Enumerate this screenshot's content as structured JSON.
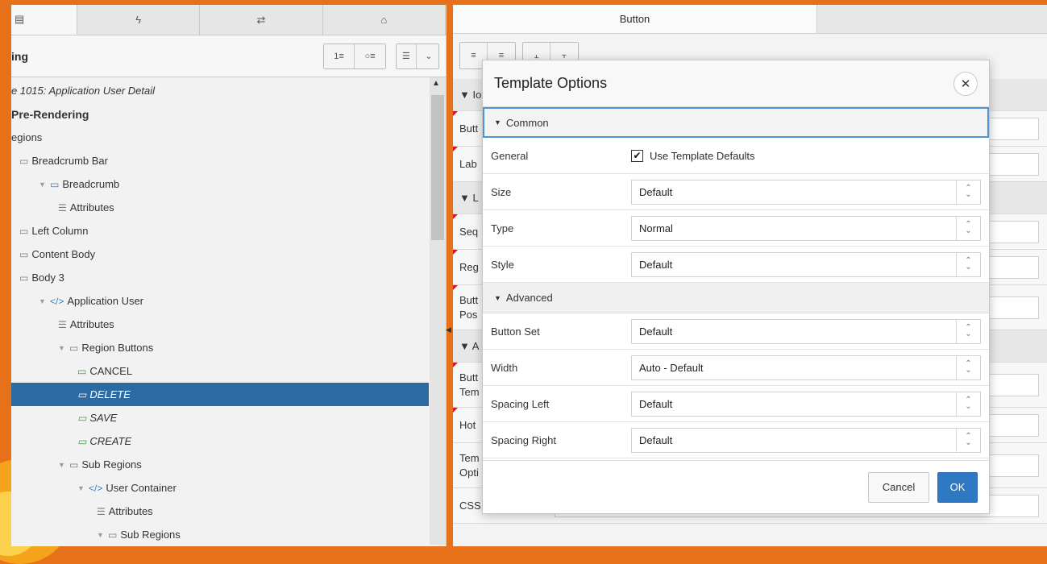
{
  "left": {
    "tabs": [
      {
        "icon": "grid-icon",
        "glyph": "▤"
      },
      {
        "icon": "lightning-icon",
        "glyph": "ϟ"
      },
      {
        "icon": "swap-icon",
        "glyph": "⇄"
      },
      {
        "icon": "shapes-icon",
        "glyph": "⌂"
      }
    ],
    "toolbar_title": "ing",
    "tree": [
      {
        "label": "e 1015: Application User Detail",
        "indent": 0,
        "style": "italic",
        "icon": ""
      },
      {
        "label": "Pre-Rendering",
        "indent": 0,
        "style": "bold",
        "icon": ""
      },
      {
        "label": "Regions",
        "indent": 0,
        "style": "",
        "icon": "",
        "display": "egions"
      },
      {
        "label": "Breadcrumb Bar",
        "indent": 1,
        "style": "",
        "icon": "folder-icon"
      },
      {
        "label": "Breadcrumb",
        "indent": 2,
        "style": "",
        "icon": "breadcrumb-icon"
      },
      {
        "label": "Attributes",
        "indent": 3,
        "style": "",
        "icon": "list-icon"
      },
      {
        "label": "Left Column",
        "indent": 1,
        "style": "",
        "icon": "folder-icon"
      },
      {
        "label": "Content Body",
        "indent": 1,
        "style": "",
        "icon": "folder-icon"
      },
      {
        "label": "Body 3",
        "indent": 1,
        "style": "",
        "icon": "folder-icon"
      },
      {
        "label": "Application User",
        "indent": 2,
        "style": "",
        "icon": "code-icon"
      },
      {
        "label": "Attributes",
        "indent": 3,
        "style": "",
        "icon": "list-icon"
      },
      {
        "label": "Region Buttons",
        "indent": 3,
        "style": "",
        "icon": "folder-icon"
      },
      {
        "label": "CANCEL",
        "indent": 4,
        "style": "",
        "icon": "button-icon"
      },
      {
        "label": "DELETE",
        "indent": 4,
        "style": "italic",
        "icon": "button-icon",
        "selected": true
      },
      {
        "label": "SAVE",
        "indent": 4,
        "style": "italic",
        "icon": "button-icon"
      },
      {
        "label": "CREATE",
        "indent": 4,
        "style": "italic",
        "icon": "button-icon"
      },
      {
        "label": "Sub Regions",
        "indent": 3,
        "style": "",
        "icon": "folder-icon"
      },
      {
        "label": "User Container",
        "indent": 4,
        "style": "",
        "icon": "code-icon"
      },
      {
        "label": "Attributes",
        "indent": 5,
        "style": "",
        "icon": "list-icon"
      },
      {
        "label": "Sub Regions",
        "indent": 5,
        "style": "",
        "icon": "folder-icon"
      }
    ]
  },
  "right": {
    "tab_label": "Button",
    "props": [
      {
        "label": "▼ Io",
        "group": true
      },
      {
        "label": "Butt",
        "mark": true
      },
      {
        "label": "Lab",
        "mark": true
      },
      {
        "label": "▼ L",
        "group": true
      },
      {
        "label": "Seq",
        "mark": true
      },
      {
        "label": "Reg",
        "mark": true
      },
      {
        "label": "Butt\nPos",
        "mark": true
      },
      {
        "label": "▼ A",
        "group": true
      },
      {
        "label": "Butt\nTem",
        "mark": true
      },
      {
        "label": "Hot",
        "mark": true
      },
      {
        "label": "Tem\nOpti",
        "mark": false
      },
      {
        "label": "CSS Classes",
        "mark": false
      }
    ]
  },
  "modal": {
    "title": "Template Options",
    "sections": {
      "common": "Common",
      "advanced": "Advanced"
    },
    "general_label": "General",
    "use_defaults_label": "Use Template Defaults",
    "use_defaults_checked": true,
    "common_options": [
      {
        "label": "Size",
        "value": "Default"
      },
      {
        "label": "Type",
        "value": "Normal"
      },
      {
        "label": "Style",
        "value": "Default"
      }
    ],
    "advanced_options": [
      {
        "label": "Button Set",
        "value": "Default"
      },
      {
        "label": "Width",
        "value": "Auto - Default"
      },
      {
        "label": "Spacing Left",
        "value": "Default"
      },
      {
        "label": "Spacing Right",
        "value": "Default"
      }
    ],
    "cancel_label": "Cancel",
    "ok_label": "OK"
  },
  "colors": {
    "accent": "#2f79c4",
    "selection": "#2b6aa2",
    "background_orange": "#e67118"
  }
}
